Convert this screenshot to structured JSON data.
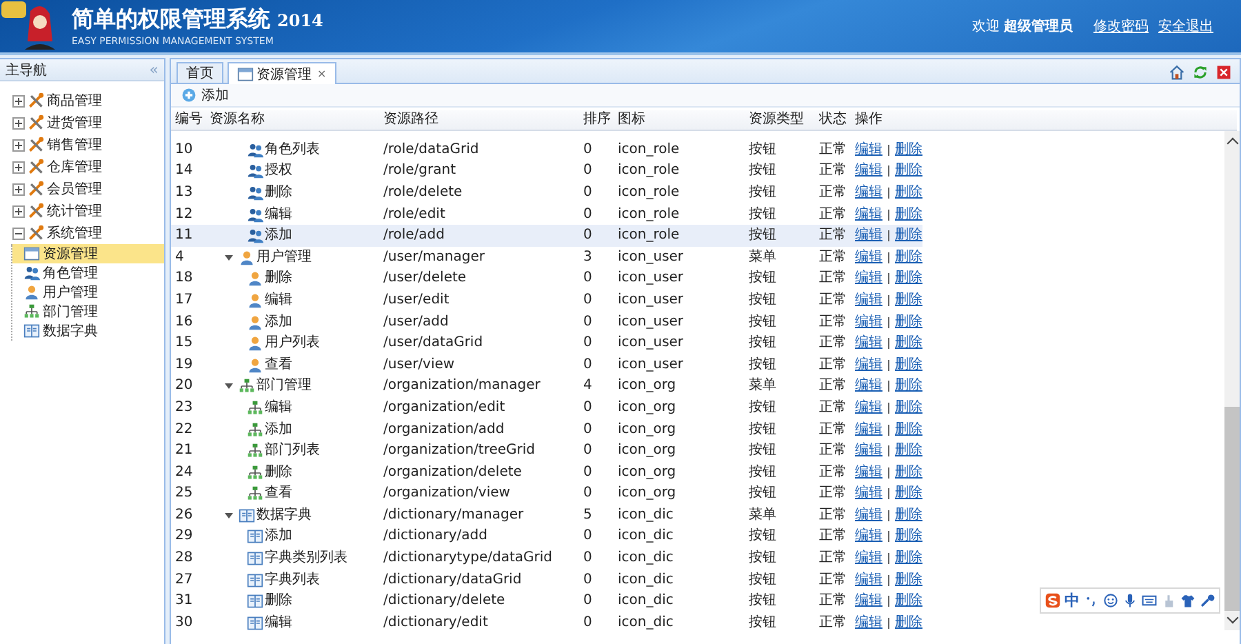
{
  "header": {
    "title": "简单的权限管理系统",
    "year": "2014",
    "subtitle": "EASY PERMISSION MANAGEMENT SYSTEM",
    "welcome": "欢迎",
    "user": "超级管理员",
    "links": [
      "修改密码",
      "安全退出"
    ]
  },
  "sidebar": {
    "title": "主导航",
    "collapse": "«",
    "items": [
      {
        "label": "商品管理",
        "expanded": false,
        "selected": false
      },
      {
        "label": "进货管理",
        "expanded": false,
        "selected": false
      },
      {
        "label": "销售管理",
        "expanded": false,
        "selected": false
      },
      {
        "label": "仓库管理",
        "expanded": false,
        "selected": false
      },
      {
        "label": "会员管理",
        "expanded": false,
        "selected": false
      },
      {
        "label": "统计管理",
        "expanded": false,
        "selected": false
      },
      {
        "label": "系统管理",
        "expanded": true,
        "selected": false,
        "children": [
          {
            "label": "资源管理",
            "kind": "resource",
            "selected": true
          },
          {
            "label": "角色管理",
            "kind": "role",
            "selected": false
          },
          {
            "label": "用户管理",
            "kind": "user",
            "selected": false
          },
          {
            "label": "部门管理",
            "kind": "org",
            "selected": false
          },
          {
            "label": "数据字典",
            "kind": "dic",
            "selected": false
          }
        ]
      }
    ]
  },
  "tabs": [
    {
      "label": "首页",
      "selected": false
    },
    {
      "label": "资源管理",
      "selected": true,
      "close": "×"
    }
  ],
  "toolbar": {
    "add": "添加"
  },
  "table": {
    "columns": [
      "编号",
      "资源名称",
      "资源路径",
      "排序",
      "图标",
      "资源类型",
      "状态",
      "操作"
    ],
    "rows": [
      {
        "id": "10",
        "name": "角色列表",
        "path": "/role/dataGrid",
        "sort": "0",
        "icon": "icon_role",
        "type": "按钮",
        "status": "正常",
        "kind": "role",
        "hovered": false,
        "actions": [
          "编辑",
          "删除"
        ]
      },
      {
        "id": "14",
        "name": "授权",
        "path": "/role/grant",
        "sort": "0",
        "icon": "icon_role",
        "type": "按钮",
        "status": "正常",
        "kind": "role",
        "hovered": false,
        "actions": [
          "编辑",
          "删除"
        ]
      },
      {
        "id": "13",
        "name": "删除",
        "path": "/role/delete",
        "sort": "0",
        "icon": "icon_role",
        "type": "按钮",
        "status": "正常",
        "kind": "role",
        "hovered": false,
        "actions": [
          "编辑",
          "删除"
        ]
      },
      {
        "id": "12",
        "name": "编辑",
        "path": "/role/edit",
        "sort": "0",
        "icon": "icon_role",
        "type": "按钮",
        "status": "正常",
        "kind": "role",
        "hovered": false,
        "actions": [
          "编辑",
          "删除"
        ]
      },
      {
        "id": "11",
        "name": "添加",
        "path": "/role/add",
        "sort": "0",
        "icon": "icon_role",
        "type": "按钮",
        "status": "正常",
        "kind": "role",
        "hovered": true,
        "actions": [
          "编辑",
          "删除"
        ]
      },
      {
        "id": "4",
        "name": "用户管理",
        "path": "/user/manager",
        "sort": "3",
        "icon": "icon_user",
        "type": "菜单",
        "status": "正常",
        "kind": "user",
        "hovered": false,
        "expanded": true,
        "actions": [
          "编辑",
          "删除"
        ],
        "children": [
          {
            "id": "18",
            "name": "删除",
            "path": "/user/delete",
            "sort": "0",
            "icon": "icon_user",
            "type": "按钮",
            "status": "正常",
            "kind": "user",
            "hovered": false,
            "actions": [
              "编辑",
              "删除"
            ]
          },
          {
            "id": "17",
            "name": "编辑",
            "path": "/user/edit",
            "sort": "0",
            "icon": "icon_user",
            "type": "按钮",
            "status": "正常",
            "kind": "user",
            "hovered": false,
            "actions": [
              "编辑",
              "删除"
            ]
          },
          {
            "id": "16",
            "name": "添加",
            "path": "/user/add",
            "sort": "0",
            "icon": "icon_user",
            "type": "按钮",
            "status": "正常",
            "kind": "user",
            "hovered": false,
            "actions": [
              "编辑",
              "删除"
            ]
          },
          {
            "id": "15",
            "name": "用户列表",
            "path": "/user/dataGrid",
            "sort": "0",
            "icon": "icon_user",
            "type": "按钮",
            "status": "正常",
            "kind": "user",
            "hovered": false,
            "actions": [
              "编辑",
              "删除"
            ]
          },
          {
            "id": "19",
            "name": "查看",
            "path": "/user/view",
            "sort": "0",
            "icon": "icon_user",
            "type": "按钮",
            "status": "正常",
            "kind": "user",
            "hovered": false,
            "actions": [
              "编辑",
              "删除"
            ]
          }
        ]
      },
      {
        "id": "20",
        "name": "部门管理",
        "path": "/organization/manager",
        "sort": "4",
        "icon": "icon_org",
        "type": "菜单",
        "status": "正常",
        "kind": "org",
        "hovered": false,
        "expanded": true,
        "actions": [
          "编辑",
          "删除"
        ],
        "children": [
          {
            "id": "23",
            "name": "编辑",
            "path": "/organization/edit",
            "sort": "0",
            "icon": "icon_org",
            "type": "按钮",
            "status": "正常",
            "kind": "org",
            "hovered": false,
            "actions": [
              "编辑",
              "删除"
            ]
          },
          {
            "id": "22",
            "name": "添加",
            "path": "/organization/add",
            "sort": "0",
            "icon": "icon_org",
            "type": "按钮",
            "status": "正常",
            "kind": "org",
            "hovered": false,
            "actions": [
              "编辑",
              "删除"
            ]
          },
          {
            "id": "21",
            "name": "部门列表",
            "path": "/organization/treeGrid",
            "sort": "0",
            "icon": "icon_org",
            "type": "按钮",
            "status": "正常",
            "kind": "org",
            "hovered": false,
            "actions": [
              "编辑",
              "删除"
            ]
          },
          {
            "id": "24",
            "name": "删除",
            "path": "/organization/delete",
            "sort": "0",
            "icon": "icon_org",
            "type": "按钮",
            "status": "正常",
            "kind": "org",
            "hovered": false,
            "actions": [
              "编辑",
              "删除"
            ]
          },
          {
            "id": "25",
            "name": "查看",
            "path": "/organization/view",
            "sort": "0",
            "icon": "icon_org",
            "type": "按钮",
            "status": "正常",
            "kind": "org",
            "hovered": false,
            "actions": [
              "编辑",
              "删除"
            ]
          }
        ]
      },
      {
        "id": "26",
        "name": "数据字典",
        "path": "/dictionary/manager",
        "sort": "5",
        "icon": "icon_dic",
        "type": "菜单",
        "status": "正常",
        "kind": "dic",
        "hovered": false,
        "expanded": true,
        "actions": [
          "编辑",
          "删除"
        ],
        "children": [
          {
            "id": "29",
            "name": "添加",
            "path": "/dictionary/add",
            "sort": "0",
            "icon": "icon_dic",
            "type": "按钮",
            "status": "正常",
            "kind": "dic",
            "hovered": false,
            "actions": [
              "编辑",
              "删除"
            ]
          },
          {
            "id": "28",
            "name": "字典类别列表",
            "path": "/dictionarytype/dataGrid",
            "sort": "0",
            "icon": "icon_dic",
            "type": "按钮",
            "status": "正常",
            "kind": "dic",
            "hovered": false,
            "actions": [
              "编辑",
              "删除"
            ]
          },
          {
            "id": "27",
            "name": "字典列表",
            "path": "/dictionary/dataGrid",
            "sort": "0",
            "icon": "icon_dic",
            "type": "按钮",
            "status": "正常",
            "kind": "dic",
            "hovered": false,
            "actions": [
              "编辑",
              "删除"
            ]
          },
          {
            "id": "31",
            "name": "删除",
            "path": "/dictionary/delete",
            "sort": "0",
            "icon": "icon_dic",
            "type": "按钮",
            "status": "正常",
            "kind": "dic",
            "hovered": false,
            "actions": [
              "编辑",
              "删除"
            ]
          },
          {
            "id": "30",
            "name": "编辑",
            "path": "/dictionary/edit",
            "sort": "0",
            "icon": "icon_dic",
            "type": "按钮",
            "status": "正常",
            "kind": "dic",
            "hovered": false,
            "actions": [
              "编辑",
              "删除"
            ]
          }
        ]
      }
    ]
  },
  "ime": {
    "label": "中"
  }
}
